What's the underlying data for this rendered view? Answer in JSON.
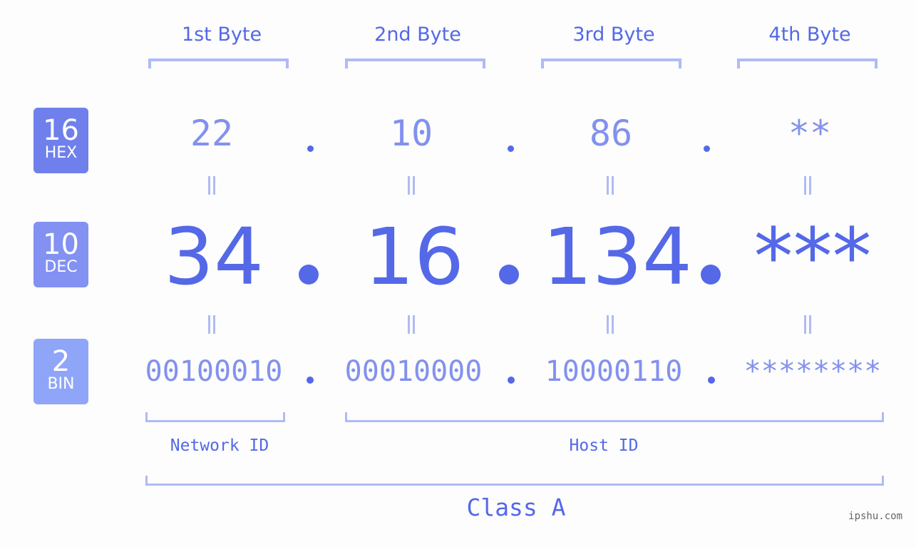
{
  "colors": {
    "accent": "#5468e8",
    "light": "#8291ee",
    "bracket": "#b0baf6",
    "hex_badge": "#6f80ec",
    "dec_badge": "#8291f2",
    "bin_badge": "#8fa5f8"
  },
  "bases": [
    {
      "num": "16",
      "label": "HEX"
    },
    {
      "num": "10",
      "label": "DEC"
    },
    {
      "num": "2",
      "label": "BIN"
    }
  ],
  "byte_headers": [
    "1st Byte",
    "2nd Byte",
    "3rd Byte",
    "4th Byte"
  ],
  "hex": [
    "22",
    "10",
    "86",
    "**"
  ],
  "dec": [
    "34",
    "16",
    "134",
    "***"
  ],
  "bin": [
    "00100010",
    "00010000",
    "10000110",
    "********"
  ],
  "network_id_label": "Network ID",
  "host_id_label": "Host ID",
  "class_label": "Class A",
  "watermark": "ipshu.com"
}
